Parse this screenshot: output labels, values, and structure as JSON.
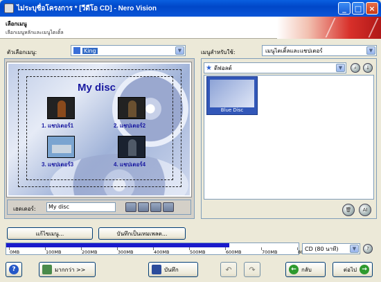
{
  "window": {
    "title": "ไม่ระบุชื่อโครงการ * [วีดีโอ CD] - Nero Vision"
  },
  "header": {
    "title": "เลือกเมนู",
    "subtitle": "เลือกเมนูหลักและเมนูไตเติ้ล"
  },
  "left": {
    "select_label": "ตัวเลือกเมนู:",
    "select_value": "King",
    "preview": {
      "disc_title": "My disc",
      "chapters": [
        "1. แชปเตอร์1",
        "2. แชปเตอร์2",
        "3. แชปเตอร์3",
        "4. แชปเตอร์4"
      ]
    },
    "header_label": "เฮดเดอร์:",
    "header_value": "My disc",
    "edit_button": "แก้ไขเมนู...",
    "save_template_button": "บันทึกเป็นเทมเพลต..."
  },
  "right": {
    "menu_for_label": "เมนูสำหรับใช้:",
    "menu_for_value": "เมนูไตเติ้ลและแชปเตอร์",
    "category_value": "ดีฟอลต์",
    "tiles": [
      {
        "name": "Blue Disc"
      }
    ]
  },
  "sizebar": {
    "ticks": [
      "0MB",
      "100MB",
      "200MB",
      "300MB",
      "400MB",
      "500MB",
      "600MB",
      "700MB",
      "800MB"
    ],
    "fill_fraction": 0.76,
    "disc_type": "CD (80 นาที)"
  },
  "footer": {
    "more_label": "มากกว่า >>",
    "save_label": "บันทึก",
    "back_label": "กลับ",
    "next_label": "ต่อไป"
  }
}
